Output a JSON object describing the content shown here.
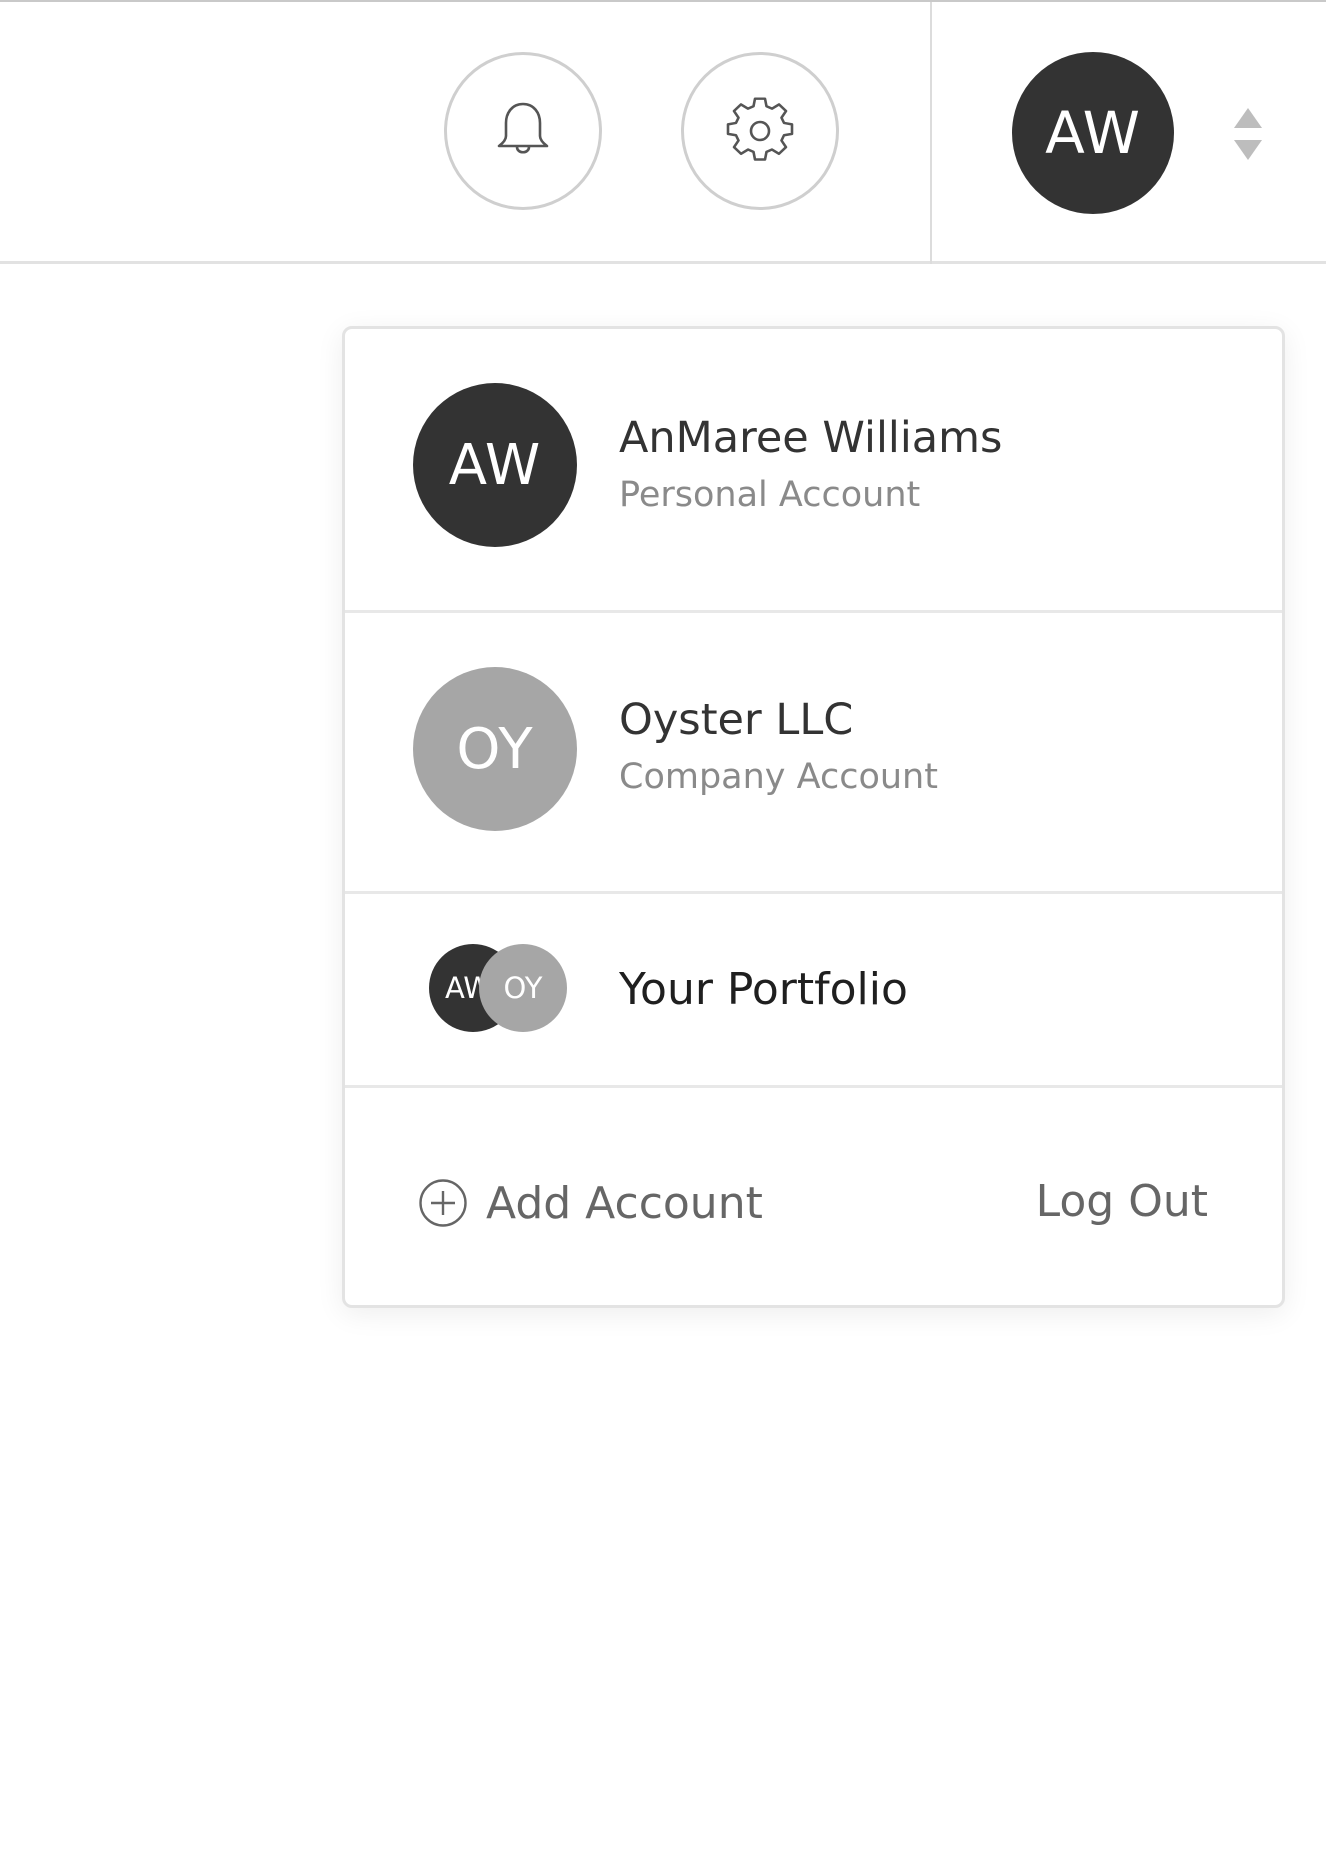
{
  "header": {
    "notifications_icon": "bell-icon",
    "settings_icon": "gear-icon",
    "user_initials": "AW",
    "switcher_icon": "sort-arrows-icon"
  },
  "dropdown": {
    "accounts": [
      {
        "initials": "AW",
        "name": "AnMaree Williams",
        "type": "Personal Account",
        "avatar_color": "#333333"
      },
      {
        "initials": "OY",
        "name": "Oyster LLC",
        "type": "Company Account",
        "avatar_color": "#a6a6a6"
      }
    ],
    "portfolio": {
      "initials": [
        "AW",
        "OY"
      ],
      "label": "Your Portfolio"
    },
    "footer": {
      "add_account_label": "Add Account",
      "add_icon": "plus-circle-icon",
      "logout_label": "Log Out"
    }
  },
  "colors": {
    "dark_avatar": "#333333",
    "light_avatar": "#a6a6a6",
    "border": "#e3e3e3",
    "muted_text": "#8a8a8a"
  }
}
